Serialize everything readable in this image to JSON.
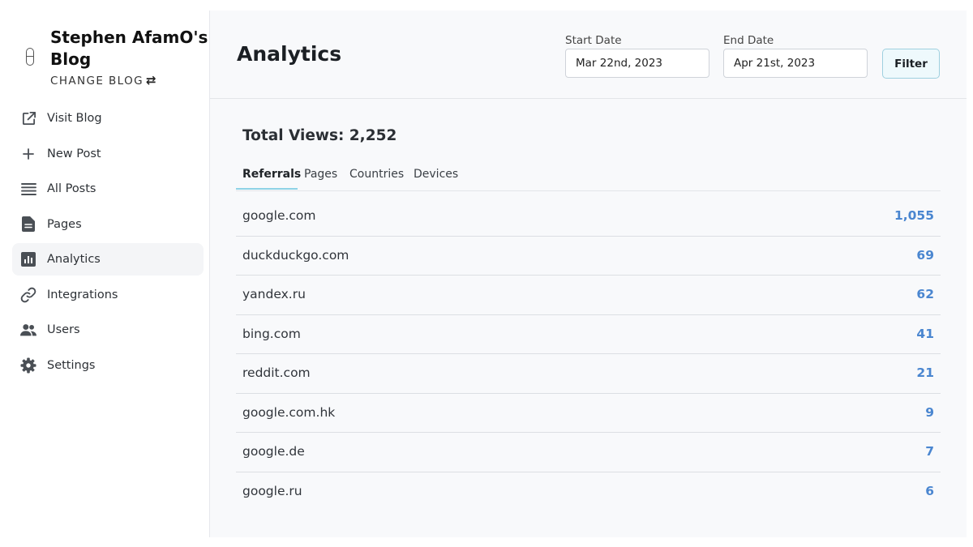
{
  "sidebar": {
    "blog_title": "Stephen AfamO's Blog",
    "change_blog_label": "CHANGE BLOG",
    "change_blog_icon": "swap-arrows-icon",
    "items": [
      {
        "label": "Visit Blog",
        "icon": "external-link-icon",
        "active": false
      },
      {
        "label": "New Post",
        "icon": "plus-icon",
        "active": false
      },
      {
        "label": "All Posts",
        "icon": "list-icon",
        "active": false
      },
      {
        "label": "Pages",
        "icon": "file-icon",
        "active": false
      },
      {
        "label": "Analytics",
        "icon": "bar-chart-icon",
        "active": true
      },
      {
        "label": "Integrations",
        "icon": "link-icon",
        "active": false
      },
      {
        "label": "Users",
        "icon": "users-icon",
        "active": false
      },
      {
        "label": "Settings",
        "icon": "gear-icon",
        "active": false
      }
    ]
  },
  "header": {
    "title": "Analytics",
    "start_date_label": "Start Date",
    "start_date_value": "Mar 22nd, 2023",
    "end_date_label": "End Date",
    "end_date_value": "Apr 21st, 2023",
    "filter_label": "Filter"
  },
  "stats": {
    "total_views": "Total Views: 2,252"
  },
  "tabs": [
    {
      "label": "Referrals",
      "active": true
    },
    {
      "label": "Pages",
      "active": false
    },
    {
      "label": "Countries",
      "active": false
    },
    {
      "label": "Devices",
      "active": false
    }
  ],
  "referrals": [
    {
      "source": "google.com",
      "count": "1,055"
    },
    {
      "source": "duckduckgo.com",
      "count": "69"
    },
    {
      "source": "yandex.ru",
      "count": "62"
    },
    {
      "source": "bing.com",
      "count": "41"
    },
    {
      "source": "reddit.com",
      "count": "21"
    },
    {
      "source": "google.com.hk",
      "count": "9"
    },
    {
      "source": "google.de",
      "count": "7"
    },
    {
      "source": "google.ru",
      "count": "6"
    }
  ],
  "colors": {
    "accent_count": "#4a86d0",
    "tab_underline": "#8fd3e6",
    "filter_bg": "#eef9fc",
    "active_nav_bg": "#f4f5f7"
  }
}
